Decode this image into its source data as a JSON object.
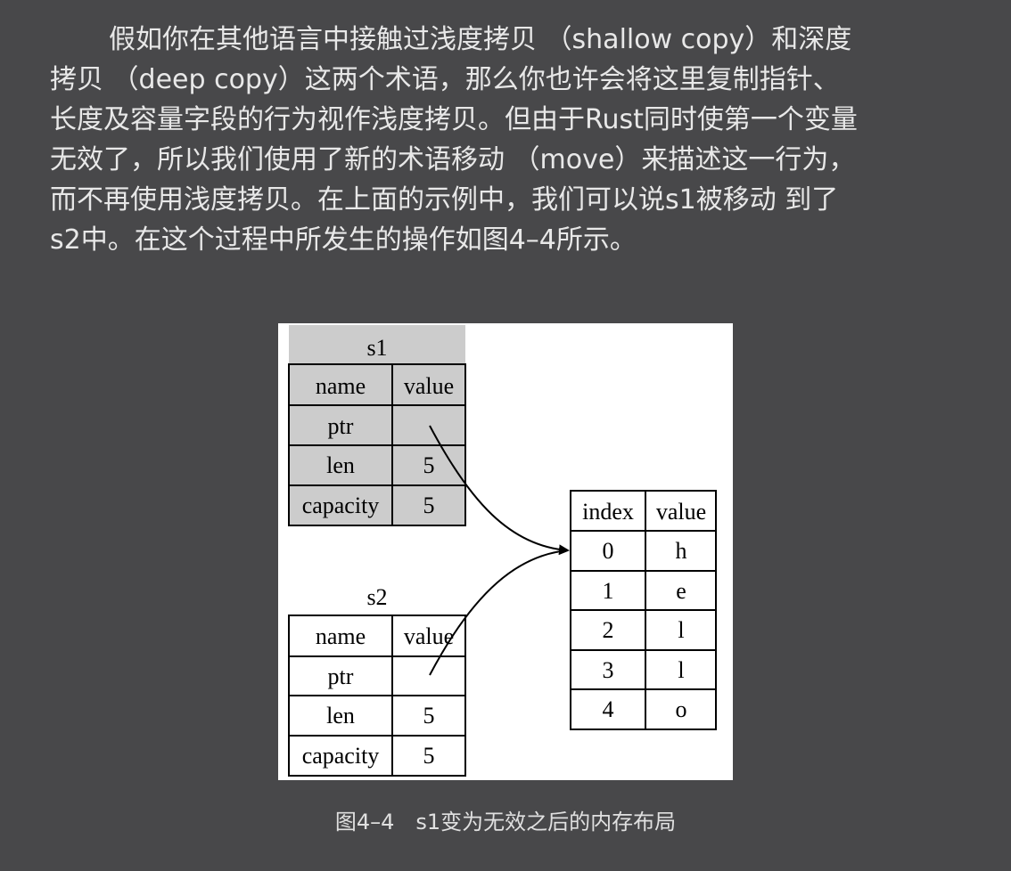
{
  "paragraph": {
    "lines": [
      "假如你在其他语言中接触过浅度拷贝 （shallow copy）和深度",
      "拷贝 （deep copy）这两个术语，那么你也许会将这里复制指针、",
      "长度及容量字段的行为视作浅度拷贝。但由于Rust同时使第一个变量",
      "无效了，所以我们使用了新的术语移动 （move）来描述这一行为，",
      "而不再使用浅度拷贝。在上面的示例中，我们可以说s1被移动 到了",
      "s2中。在这个过程中所发生的操作如图4–4所示。"
    ]
  },
  "figure": {
    "s1": {
      "title": "s1",
      "header": [
        "name",
        "value"
      ],
      "rows": [
        [
          "ptr",
          ""
        ],
        [
          "len",
          "5"
        ],
        [
          "capacity",
          "5"
        ]
      ]
    },
    "s2": {
      "title": "s2",
      "header": [
        "name",
        "value"
      ],
      "rows": [
        [
          "ptr",
          ""
        ],
        [
          "len",
          "5"
        ],
        [
          "capacity",
          "5"
        ]
      ]
    },
    "heap": {
      "header": [
        "index",
        "value"
      ],
      "rows": [
        [
          "0",
          "h"
        ],
        [
          "1",
          "e"
        ],
        [
          "2",
          "l"
        ],
        [
          "3",
          "l"
        ],
        [
          "4",
          "o"
        ]
      ]
    },
    "colors": {
      "s1_fill": "#cccccc",
      "s2_fill": "#ffffff",
      "border": "#000000"
    }
  },
  "caption": "图4–4　s1变为无效之后的内存布局"
}
